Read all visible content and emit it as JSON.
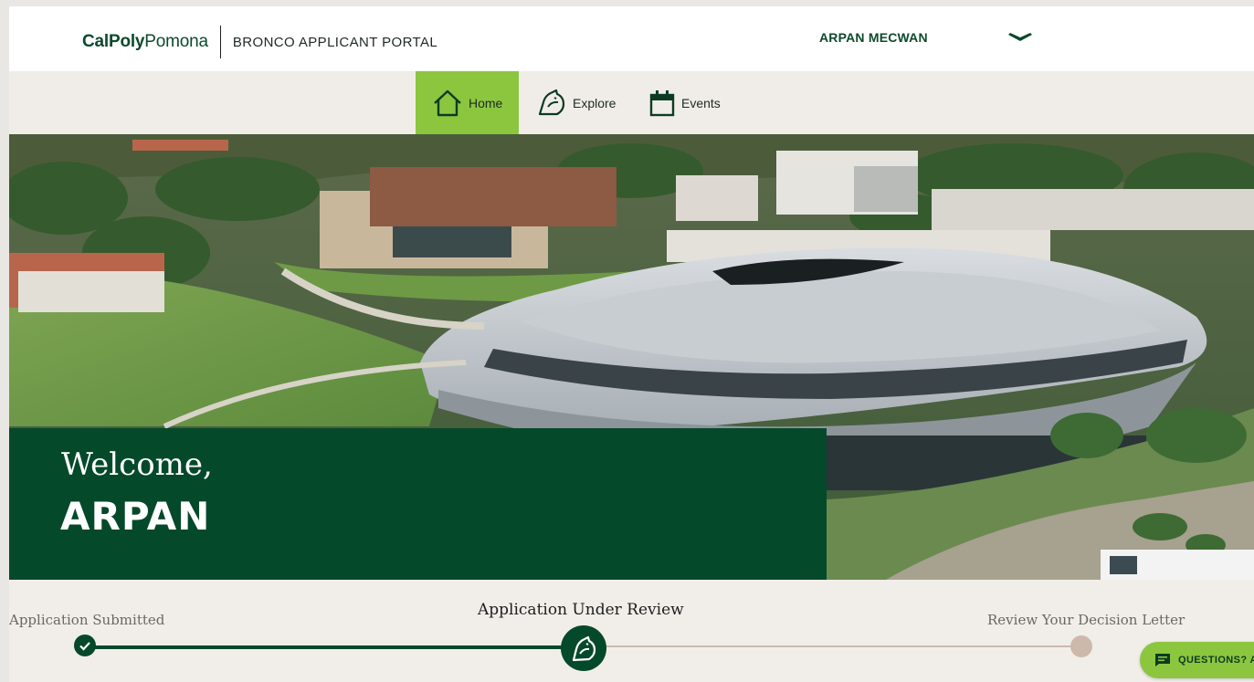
{
  "header": {
    "logo_bold": "CalPoly",
    "logo_light": "Pomona",
    "portal_title": "BRONCO APPLICANT PORTAL",
    "user_name": "ARPAN MECWAN",
    "user_menu_icon": "chevron-down-icon"
  },
  "nav": {
    "items": [
      {
        "label": "Home",
        "icon": "home-icon",
        "active": true
      },
      {
        "label": "Explore",
        "icon": "bronco-icon",
        "active": false
      },
      {
        "label": "Events",
        "icon": "calendar-icon",
        "active": false
      }
    ]
  },
  "hero": {
    "greeting": "Welcome,",
    "name": "ARPAN"
  },
  "progress": {
    "steps": [
      {
        "label": "Application Submitted",
        "status": "complete"
      },
      {
        "label": "Application Under Review",
        "status": "current"
      },
      {
        "label": "Review Your Decision Letter",
        "status": "upcoming"
      }
    ]
  },
  "help": {
    "label": "QUESTIONS? AS"
  },
  "colors": {
    "brand_green": "#05492b",
    "accent_green": "#8cc63f",
    "background": "#f1eee9",
    "upcoming": "#cdb9ac"
  }
}
